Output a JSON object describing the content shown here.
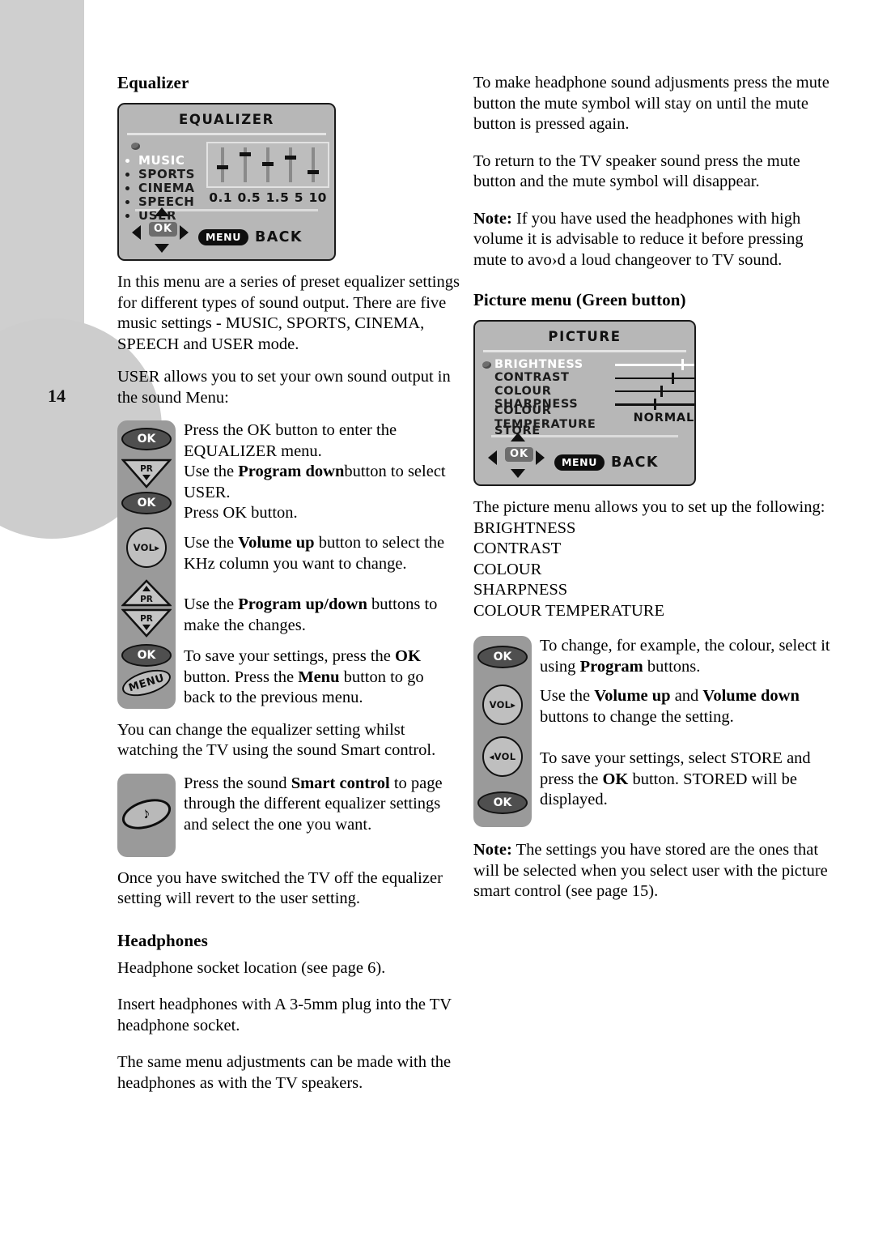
{
  "page": {
    "number": "14"
  },
  "left_column": {
    "heading_equalizer": "Equalizer",
    "equalizer_osd": {
      "title": "EQUALIZER",
      "modes": [
        "MUSIC",
        "SPORTS",
        "CINEMA",
        "SPEECH",
        "USER"
      ],
      "selected_mode": "MUSIC",
      "scale_labels": [
        "0.1",
        "0.5",
        "1.5",
        "5",
        "10"
      ],
      "slider_positions_pct": [
        52,
        18,
        42,
        26,
        64
      ],
      "ok_label": "OK",
      "menu_label": "MENU",
      "back_label": "BACK"
    },
    "para_intro": "In this menu are a series of preset equalizer settings for different types of sound output. There are five music settings - MUSIC, SPORTS, CINEMA, SPEECH and USER mode.",
    "para_user": "USER allows you to set your own sound output in the sound Menu:",
    "steps": [
      {
        "key": "ok-key",
        "key_label": "OK",
        "text_parts": [
          {
            "t": "Press the OK button to enter the EQUALIZER menu.",
            "bold": false
          }
        ]
      },
      {
        "key": "program-down-key",
        "key_label": "PR",
        "text_parts": [
          {
            "t": "Use the ",
            "bold": false
          },
          {
            "t": "Program down",
            "bold": true
          },
          {
            "t": "button to select USER.",
            "bold": false
          }
        ]
      },
      {
        "key": "ok-key",
        "key_label": "OK",
        "text_parts": [
          {
            "t": "Press OK button.",
            "bold": false
          }
        ]
      },
      {
        "key": "volume-up-key",
        "key_label": "VOL",
        "text_parts": [
          {
            "t": "Use the ",
            "bold": false
          },
          {
            "t": "Volume up",
            "bold": true
          },
          {
            "t": " button to select the KHz column you want to change.",
            "bold": false
          }
        ]
      },
      {
        "key": "program-updown-key",
        "key_label": "PR",
        "text_parts": [
          {
            "t": "Use the ",
            "bold": false
          },
          {
            "t": "Program up/down",
            "bold": true
          },
          {
            "t": " buttons to make the changes.",
            "bold": false
          }
        ]
      },
      {
        "key": "ok-menu-key",
        "key_label": "OK",
        "text_parts": [
          {
            "t": "To save your settings, press the ",
            "bold": false
          },
          {
            "t": "OK",
            "bold": true
          },
          {
            "t": " button. Press the ",
            "bold": false
          },
          {
            "t": "Menu",
            "bold": true
          },
          {
            "t": " button to go back to the previous menu.",
            "bold": false
          }
        ]
      }
    ],
    "para_smart_intro": "You can change the equalizer setting whilst watching the TV using the sound Smart control.",
    "smart_step": {
      "key": "sound-smart-control-key",
      "text_parts": [
        {
          "t": "Press the sound ",
          "bold": false
        },
        {
          "t": "Smart control",
          "bold": true
        },
        {
          "t": " to page through the different equalizer settings and select the one you  want.",
          "bold": false
        }
      ]
    },
    "para_revert": "Once you have switched the TV off the equalizer setting will revert to the user setting.",
    "heading_headphones": "Headphones",
    "para_socket": "Headphone socket location (see page 6).",
    "para_insert": "Insert headphones with A 3-5mm plug into the TV headphone socket.",
    "para_same_menu": "The same menu adjustments can be made with the headphones as with the TV speakers."
  },
  "right_column": {
    "para_mute_1": "To make headphone sound adjusments press the mute button the mute symbol will stay on until the mute button is pressed again.",
    "para_mute_2": "To return to the TV speaker sound press the mute button and the mute symbol will disappear.",
    "note_headphones": {
      "label": "Note:",
      "text": " If you have used the headphones with high volume it is advisable to reduce it before pressing mute to avo›d a loud changeover to TV sound."
    },
    "heading_picture_menu": "Picture menu (Green button)",
    "picture_osd": {
      "title": "PICTURE",
      "rows": [
        {
          "label": "BRIGHTNESS",
          "type": "slider",
          "position_pct": 84,
          "selected": true
        },
        {
          "label": "CONTRAST",
          "type": "slider",
          "position_pct": 71,
          "selected": false
        },
        {
          "label": "COLOUR",
          "type": "slider",
          "position_pct": 57,
          "selected": false
        },
        {
          "label": "SHARPNESS",
          "type": "slider",
          "position_pct": 49,
          "selected": false
        },
        {
          "label": "COLOUR TEMPERATURE",
          "type": "value",
          "value": "NORMAL",
          "selected": false
        },
        {
          "label": "STORE",
          "type": "none",
          "selected": false
        }
      ],
      "ok_label": "OK",
      "menu_label": "MENU",
      "back_label": "BACK"
    },
    "para_allows": "The picture menu allows you to set up the following:",
    "setting_list": [
      "BRIGHTNESS",
      "CONTRAST",
      "COLOUR",
      "SHARPNESS",
      "COLOUR TEMPERATURE"
    ],
    "steps": [
      {
        "key": "ok-key",
        "key_label": "OK",
        "text_parts": [
          {
            "t": "To change, for example, the colour, select it using ",
            "bold": false
          },
          {
            "t": "Program",
            "bold": true
          },
          {
            "t": " buttons.",
            "bold": false
          }
        ]
      },
      {
        "key": "volume-up-key",
        "key_label": "VOL",
        "text_parts": [
          {
            "t": "Use the ",
            "bold": false
          },
          {
            "t": "Volume up",
            "bold": true
          },
          {
            "t": "  and ",
            "bold": false
          },
          {
            "t": "Volume down",
            "bold": true
          },
          {
            "t": "  buttons to change the setting.",
            "bold": false
          }
        ]
      },
      {
        "key": "volume-down-key",
        "key_label": "VOL",
        "text_parts": []
      },
      {
        "key": "ok-key",
        "key_label": "OK",
        "text_parts": [
          {
            "t": "To save your settings, select STORE and press the ",
            "bold": false
          },
          {
            "t": "OK",
            "bold": true
          },
          {
            "t": " button. STORED will be displayed.",
            "bold": false
          }
        ]
      }
    ],
    "note_stored": {
      "label": "Note:",
      "text": " The settings you have stored are the ones that will be selected when you select user with the picture smart control (see page 15)."
    }
  },
  "colors": {
    "osd_background": "#b7b7b7",
    "panel_gray": "#9a9a9a",
    "deco_gray": "#cfcfcf",
    "ok_key": "#4f4f4f"
  }
}
